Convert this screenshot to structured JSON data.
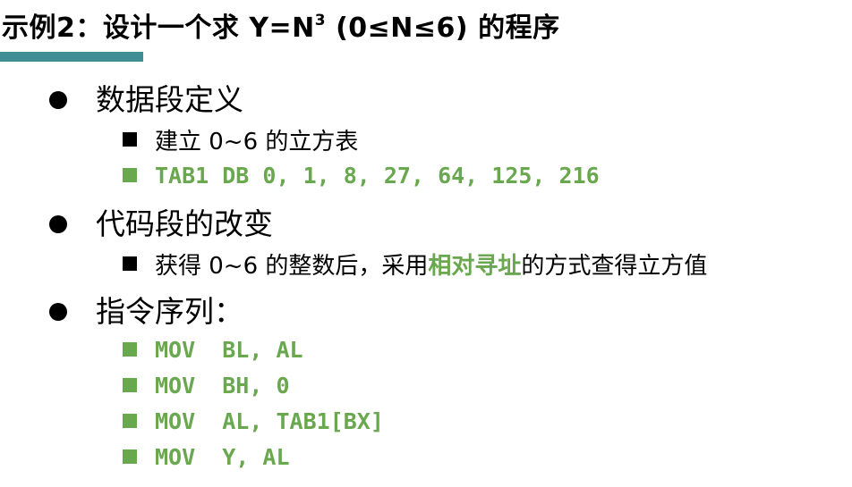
{
  "title": {
    "main": "示例2：设计一个求 Y=N",
    "superscript": "3",
    "tail": " (0≤N≤6) 的程序"
  },
  "colors": {
    "accent_bar": "#3e8e93",
    "highlight_green": "#6aa84f"
  },
  "sections": [
    {
      "heading": "数据段定义",
      "items": [
        {
          "text": "建立 0~6 的立方表"
        },
        {
          "code": "TAB1 DB 0, 1, 8, 27, 64, 125, 216"
        }
      ]
    },
    {
      "heading": "代码段的改变",
      "items": [
        {
          "before": "获得 0~6 的整数后，采用",
          "highlight": "相对寻址",
          "after": "的方式查得立方值"
        }
      ]
    },
    {
      "heading": "指令序列：",
      "items": [
        {
          "code": "MOV  BL, AL"
        },
        {
          "code": "MOV  BH, 0"
        },
        {
          "code": "MOV  AL, TAB1[BX]"
        },
        {
          "code": "MOV  Y, AL"
        }
      ]
    }
  ]
}
